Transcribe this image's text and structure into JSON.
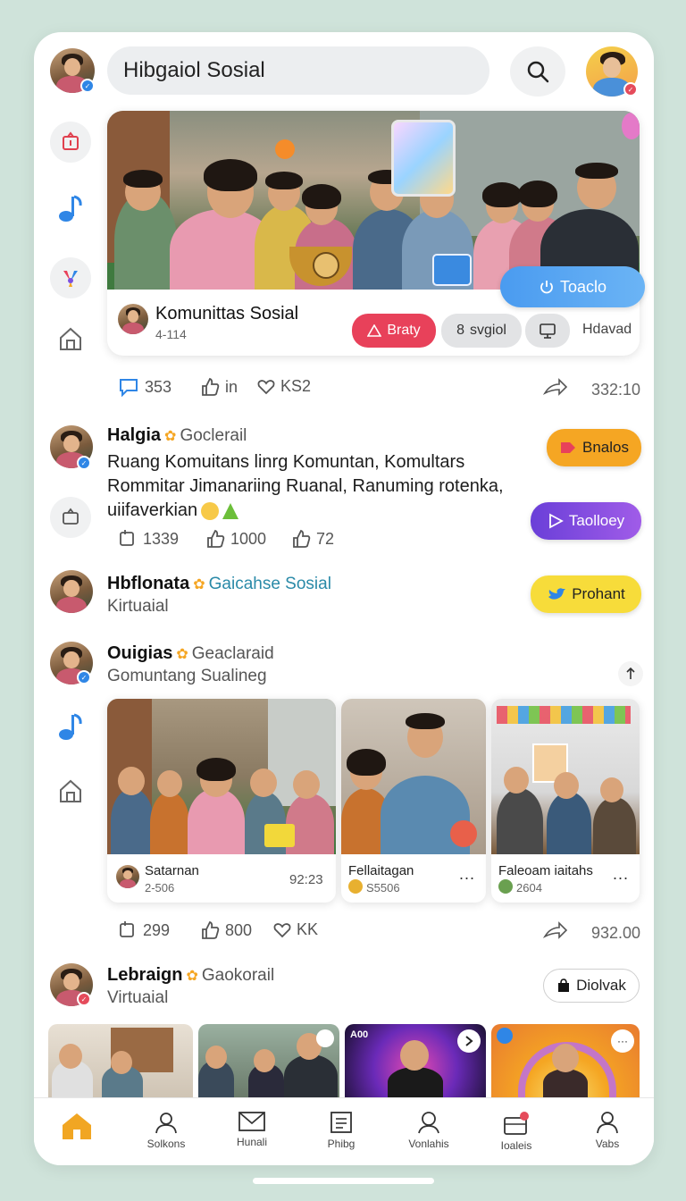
{
  "header": {
    "search_text": "Hibgaiol Sosial"
  },
  "featured_post": {
    "author_name": "Komunittas Sosial",
    "author_meta": "4-114",
    "tags": [
      {
        "label": "Braty"
      },
      {
        "label": "svgiol"
      },
      {
        "label": "Hdavad"
      }
    ],
    "overlay_button": "Toaclo",
    "stats": {
      "comments": "353",
      "likes": "in",
      "hearts": "KS2",
      "shares": "332:10"
    }
  },
  "posts": [
    {
      "name": "Halgia",
      "handle": "Goclerail",
      "text_line1": "Ruang Komuitans linrg Komuntan, Komultars",
      "text_line2": "Rommitar Jimanariing Ruanal, Ranuming rotenka,",
      "text_line3": "uiifaverkian",
      "action": "Bnalos",
      "stats": {
        "a": "1339",
        "b": "1000",
        "c": "72"
      }
    },
    {
      "name": "Hbflonata",
      "handle": "Gaicahse Sosial",
      "sub": "Kirtuaial",
      "action": "Prohant"
    },
    {
      "name": "Ouigias",
      "handle": "Geaclaraid",
      "sub": "Gomuntang Sualineg",
      "gallery": [
        {
          "title": "Satarnan",
          "meta": "2-506",
          "time": "92:23"
        },
        {
          "title": "Fellaitagan",
          "meta": "S5506",
          "more": "..."
        },
        {
          "title": "Faleoam iaitahs",
          "meta": "2604",
          "more": "..."
        }
      ],
      "stats": {
        "a": "299",
        "b": "800",
        "c": "KK",
        "shares": "932.00"
      }
    },
    {
      "name": "Lebraign",
      "handle": "Gaokorail",
      "sub": "Virtuaial",
      "action": "Diolvak"
    }
  ],
  "second_action": "Taolloey",
  "bottom_strip": {
    "third_label": "A00"
  },
  "tabbar": [
    {
      "label": "Solkons"
    },
    {
      "label": "Hunali"
    },
    {
      "label": "Phibg"
    },
    {
      "label": "Vonlahis"
    },
    {
      "label": "Ioaleis"
    },
    {
      "label": "Vabs"
    }
  ],
  "colors": {
    "accent_blue": "#2f86e6",
    "accent_red": "#e8415a",
    "accent_orange": "#f5a623",
    "accent_purple": "#7b4fe0",
    "accent_yellow": "#f7dc3a",
    "home_tab": "#f1a623"
  }
}
